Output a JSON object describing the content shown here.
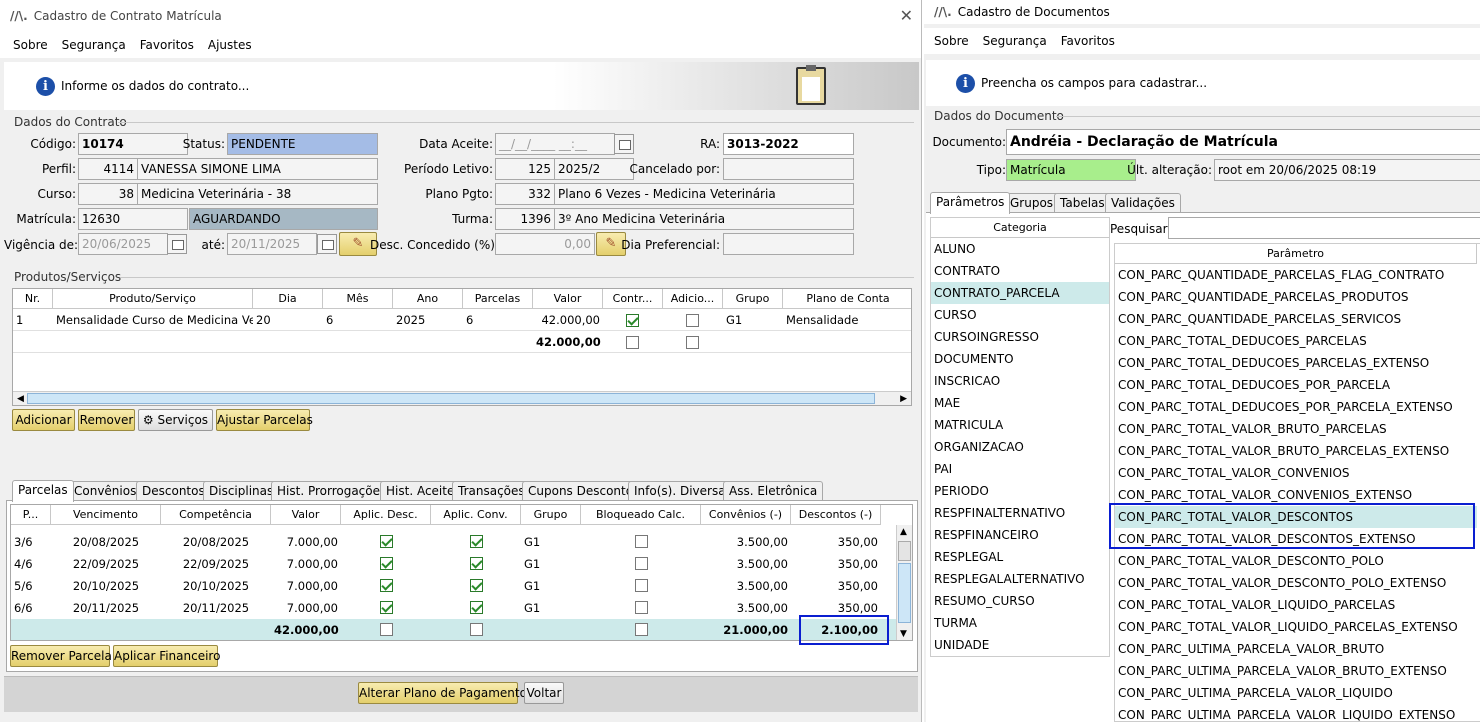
{
  "left": {
    "title": "Cadastro de Contrato Matrícula",
    "logo": "//\\.",
    "menu": [
      "Sobre",
      "Segurança",
      "Favoritos",
      "Ajustes"
    ],
    "info": "Informe os dados do contrato...",
    "section_contract": "Dados do Contrato",
    "labels": {
      "codigo": "Código:",
      "status": "Status:",
      "data_aceite": "Data Aceite:",
      "ra": "RA:",
      "perfil": "Perfil:",
      "periodo": "Período Letivo:",
      "cancelado": "Cancelado por:",
      "curso": "Curso:",
      "plano": "Plano Pgto:",
      "matricula": "Matrícula:",
      "turma": "Turma:",
      "vigencia": "Vigência de:",
      "ate": "até:",
      "desc_concedido": "Desc. Concedido (%):",
      "dia_pref": "Dia Preferencial:"
    },
    "fields": {
      "codigo": "10174",
      "status": "PENDENTE",
      "data_aceite": "__/__/____ __:__",
      "ra": "3013-2022",
      "perfil_id": "4114",
      "perfil_nome": "VANESSA SIMONE LIMA",
      "periodo_id": "125",
      "periodo_nome": "2025/2",
      "cancelado": "",
      "curso_id": "38",
      "curso_nome": "Medicina Veterinária - 38",
      "plano_id": "332",
      "plano_nome": "Plano 6 Vezes - Medicina Veterinária",
      "matricula_id": "12630",
      "matricula_status": "AGUARDANDO",
      "turma_id": "1396",
      "turma_nome": "3º Ano Medicina Veterinária",
      "vigencia_de": "20/06/2025",
      "vigencia_ate": "20/11/2025",
      "desc_concedido": "0,00",
      "dia_pref": ""
    },
    "section_products": "Produtos/Serviços",
    "products": {
      "headers": [
        "Nr.",
        "Produto/Serviço",
        "Dia",
        "Mês",
        "Ano",
        "Parcelas",
        "Valor",
        "Contr...",
        "Adicio...",
        "Grupo",
        "Plano de Conta"
      ],
      "rows": [
        {
          "nr": "1",
          "produto": "Mensalidade Curso de Medicina Ve...",
          "dia": "20",
          "mes": "6",
          "ano": "2025",
          "parcelas": "6",
          "valor": "42.000,00",
          "contr": true,
          "adic": false,
          "grupo": "G1",
          "plano": "Mensalidade"
        }
      ],
      "total_valor": "42.000,00"
    },
    "product_buttons": [
      "Adicionar",
      "Remover",
      "Serviços",
      "Ajustar Parcelas"
    ],
    "tabs": [
      "Parcelas",
      "Convênios",
      "Descontos",
      "Disciplinas",
      "Hist. Prorrogações",
      "Hist. Aceite",
      "Transações",
      "Cupons Desconto",
      "Info(s). Diversas",
      "Ass. Eletrônica"
    ],
    "parcelas": {
      "headers": [
        "P...",
        "Vencimento",
        "Competência",
        "Valor",
        "Aplic. Desc.",
        "Aplic. Conv.",
        "Grupo",
        "Bloqueado Calc.",
        "Convênios (-)",
        "Descontos (-)"
      ],
      "rows": [
        {
          "p": "3/6",
          "venc": "20/08/2025",
          "comp": "20/08/2025",
          "valor": "7.000,00",
          "desc": true,
          "conv": true,
          "grupo": "G1",
          "bloq": false,
          "convenios": "3.500,00",
          "descontos": "350,00"
        },
        {
          "p": "4/6",
          "venc": "22/09/2025",
          "comp": "22/09/2025",
          "valor": "7.000,00",
          "desc": true,
          "conv": true,
          "grupo": "G1",
          "bloq": false,
          "convenios": "3.500,00",
          "descontos": "350,00"
        },
        {
          "p": "5/6",
          "venc": "20/10/2025",
          "comp": "20/10/2025",
          "valor": "7.000,00",
          "desc": true,
          "conv": true,
          "grupo": "G1",
          "bloq": false,
          "convenios": "3.500,00",
          "descontos": "350,00"
        },
        {
          "p": "6/6",
          "venc": "20/11/2025",
          "comp": "20/11/2025",
          "valor": "7.000,00",
          "desc": true,
          "conv": true,
          "grupo": "G1",
          "bloq": false,
          "convenios": "3.500,00",
          "descontos": "350,00"
        }
      ],
      "total_valor": "42.000,00",
      "total_convenios": "21.000,00",
      "total_descontos": "2.100,00"
    },
    "parcela_buttons": [
      "Remover Parcela",
      "Aplicar Financeiro"
    ],
    "footer_buttons": [
      "Alterar Plano de Pagamento",
      "Voltar"
    ]
  },
  "right": {
    "title": "Cadastro de Documentos",
    "logo": "//\\.",
    "menu": [
      "Sobre",
      "Segurança",
      "Favoritos"
    ],
    "info": "Preencha os campos para cadastrar...",
    "section_doc": "Dados do Documento",
    "doc_label": "Documento:",
    "doc_value": "Andréia - Declaração de Matrícula",
    "tipo_label": "Tipo:",
    "tipo_value": "Matrícula",
    "ult_label": "Últ. alteração:",
    "ult_value": "root em 20/06/2025 08:19",
    "tabs": [
      "Parâmetros",
      "Grupos",
      "Tabelas",
      "Validações"
    ],
    "categoria_header": "Categoria",
    "categorias": [
      "ALUNO",
      "CONTRATO",
      "CONTRATO_PARCELA",
      "CURSO",
      "CURSOINGRESSO",
      "DOCUMENTO",
      "INSCRICAO",
      "MAE",
      "MATRICULA",
      "ORGANIZACAO",
      "PAI",
      "PERIODO",
      "RESPFINALTERNATIVO",
      "RESPFINANCEIRO",
      "RESPLEGAL",
      "RESPLEGALALTERNATIVO",
      "RESUMO_CURSO",
      "TURMA",
      "UNIDADE"
    ],
    "selected_categoria": "CONTRATO_PARCELA",
    "search_label": "Pesquisar:",
    "parametro_header": "Parâmetro",
    "parametros": [
      "CON_PARC_QUANTIDADE_PARCELAS_FLAG_CONTRATO",
      "CON_PARC_QUANTIDADE_PARCELAS_PRODUTOS",
      "CON_PARC_QUANTIDADE_PARCELAS_SERVICOS",
      "CON_PARC_TOTAL_DEDUCOES_PARCELAS",
      "CON_PARC_TOTAL_DEDUCOES_PARCELAS_EXTENSO",
      "CON_PARC_TOTAL_DEDUCOES_POR_PARCELA",
      "CON_PARC_TOTAL_DEDUCOES_POR_PARCELA_EXTENSO",
      "CON_PARC_TOTAL_VALOR_BRUTO_PARCELAS",
      "CON_PARC_TOTAL_VALOR_BRUTO_PARCELAS_EXTENSO",
      "CON_PARC_TOTAL_VALOR_CONVENIOS",
      "CON_PARC_TOTAL_VALOR_CONVENIOS_EXTENSO",
      "CON_PARC_TOTAL_VALOR_DESCONTOS",
      "CON_PARC_TOTAL_VALOR_DESCONTOS_EXTENSO",
      "CON_PARC_TOTAL_VALOR_DESCONTO_POLO",
      "CON_PARC_TOTAL_VALOR_DESCONTO_POLO_EXTENSO",
      "CON_PARC_TOTAL_VALOR_LIQUIDO_PARCELAS",
      "CON_PARC_TOTAL_VALOR_LIQUIDO_PARCELAS_EXTENSO",
      "CON_PARC_ULTIMA_PARCELA_VALOR_BRUTO",
      "CON_PARC_ULTIMA_PARCELA_VALOR_BRUTO_EXTENSO",
      "CON_PARC_ULTIMA_PARCELA_VALOR_LIQUIDO",
      "CON_PARC_ULTIMA_PARCELA_VALOR_LIQUIDO_EXTENSO"
    ],
    "selected_parametro": "CON_PARC_TOTAL_VALOR_DESCONTOS"
  },
  "colors": {
    "status_blue": "#a4bce6",
    "status_gray": "#a6b8c4",
    "tipo_green": "#a8ee8c",
    "selection": "#cdeaea",
    "highlight": "#0a1ed0",
    "info_blue": "#1c4fa8"
  }
}
